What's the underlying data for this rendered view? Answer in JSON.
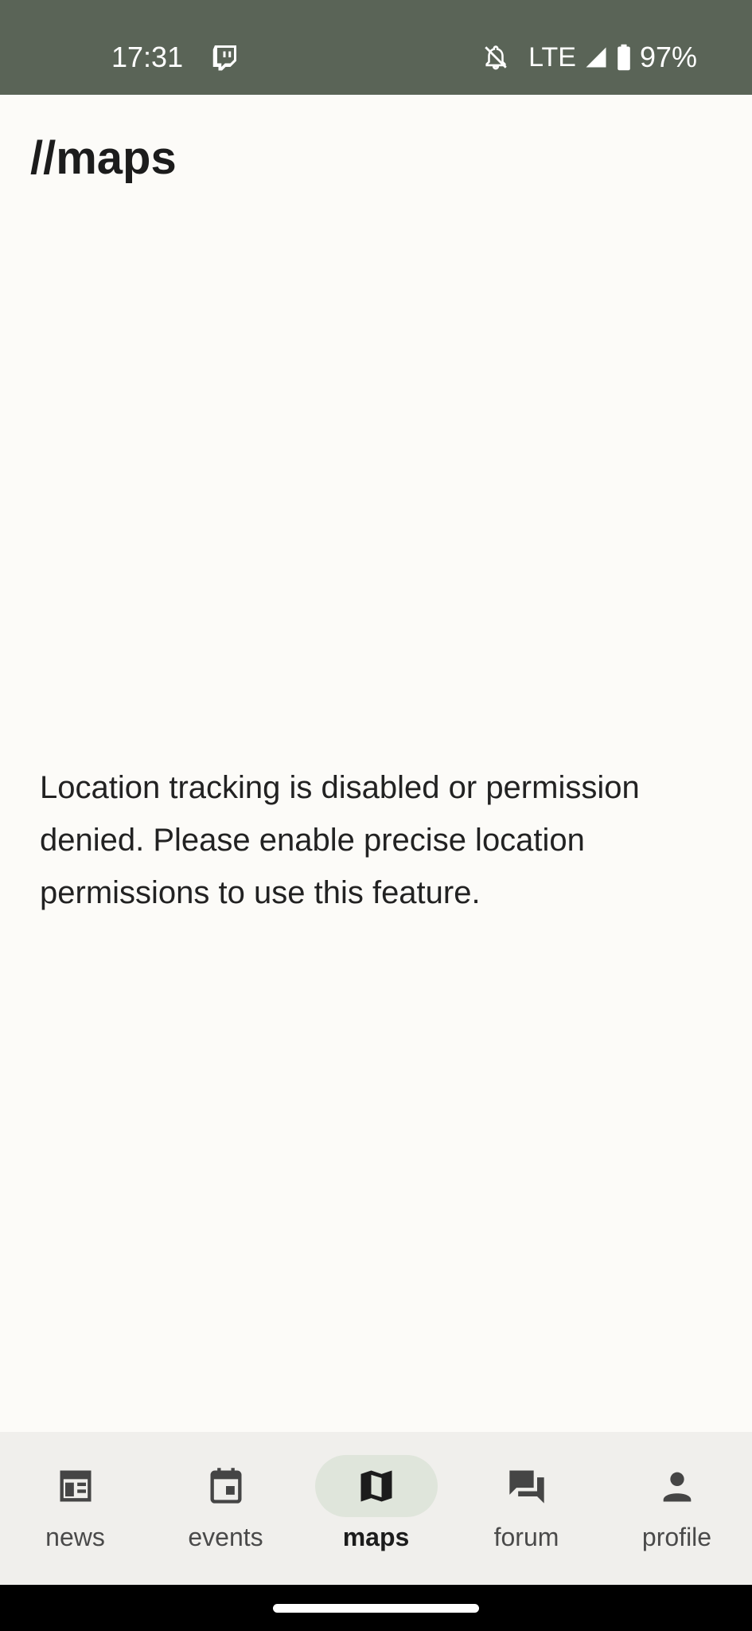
{
  "status_bar": {
    "time": "17:31",
    "network": "LTE",
    "battery": "97%",
    "icons": [
      "twitch-icon",
      "bell-off-icon",
      "signal-icon",
      "battery-icon"
    ],
    "background": "#5a6457"
  },
  "page": {
    "title": "//maps",
    "message": "Location tracking is disabled or permission denied. Please enable precise location permissions to use this feature."
  },
  "bottom_nav": {
    "items": [
      {
        "label": "news",
        "icon": "newspaper-icon",
        "active": false
      },
      {
        "label": "events",
        "icon": "calendar-icon",
        "active": false
      },
      {
        "label": "maps",
        "icon": "map-icon",
        "active": true
      },
      {
        "label": "forum",
        "icon": "forum-icon",
        "active": false
      },
      {
        "label": "profile",
        "icon": "person-icon",
        "active": false
      }
    ],
    "active_pill_color": "#dfe5db"
  }
}
